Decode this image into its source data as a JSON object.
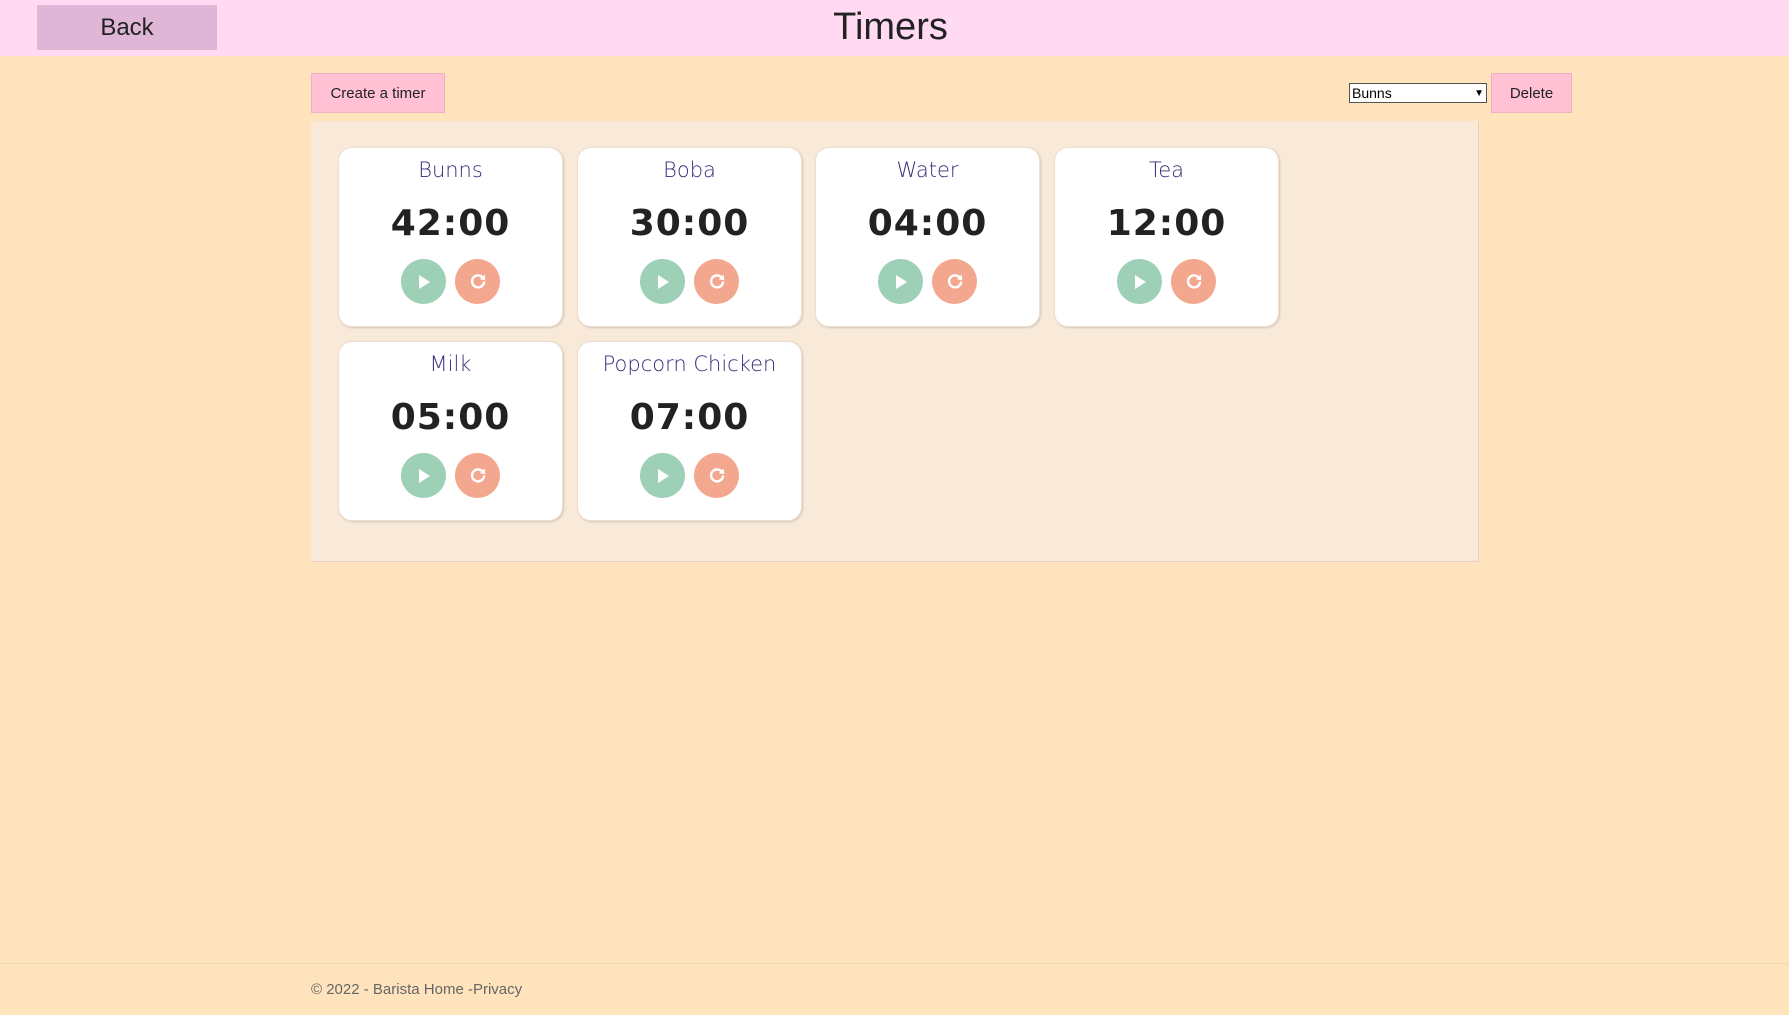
{
  "header": {
    "back_label": "Back",
    "title": "Timers"
  },
  "toolbar": {
    "create_label": "Create a timer",
    "select_value": "Bunns",
    "delete_label": "Delete"
  },
  "timers": [
    {
      "name": "Bunns",
      "time": "42:00",
      "play_icon": "play-icon",
      "reset_icon": "reset-icon"
    },
    {
      "name": "Boba",
      "time": "30:00",
      "play_icon": "play-icon",
      "reset_icon": "reset-icon"
    },
    {
      "name": "Water",
      "time": "04:00",
      "play_icon": "play-icon",
      "reset_icon": "reset-icon"
    },
    {
      "name": "Tea",
      "time": "12:00",
      "play_icon": "play-icon",
      "reset_icon": "reset-icon"
    },
    {
      "name": "Milk",
      "time": "05:00",
      "play_icon": "play-icon",
      "reset_icon": "reset-icon"
    },
    {
      "name": "Popcorn Chicken",
      "time": "07:00",
      "play_icon": "play-icon",
      "reset_icon": "reset-icon"
    }
  ],
  "footer": {
    "copyright": "© 2022 - Barista Home -",
    "privacy_link": "Privacy"
  },
  "colors": {
    "page_bg": "#ffe3bd",
    "header_bg": "#ffdaf2",
    "back_button": "#dfb6d6",
    "action_button": "#ffc1d3",
    "panel_bg": "#f8e9d8",
    "play_button": "#9dd0b7",
    "reset_button": "#f3a78f",
    "timer_name": "#3b2a7a"
  }
}
